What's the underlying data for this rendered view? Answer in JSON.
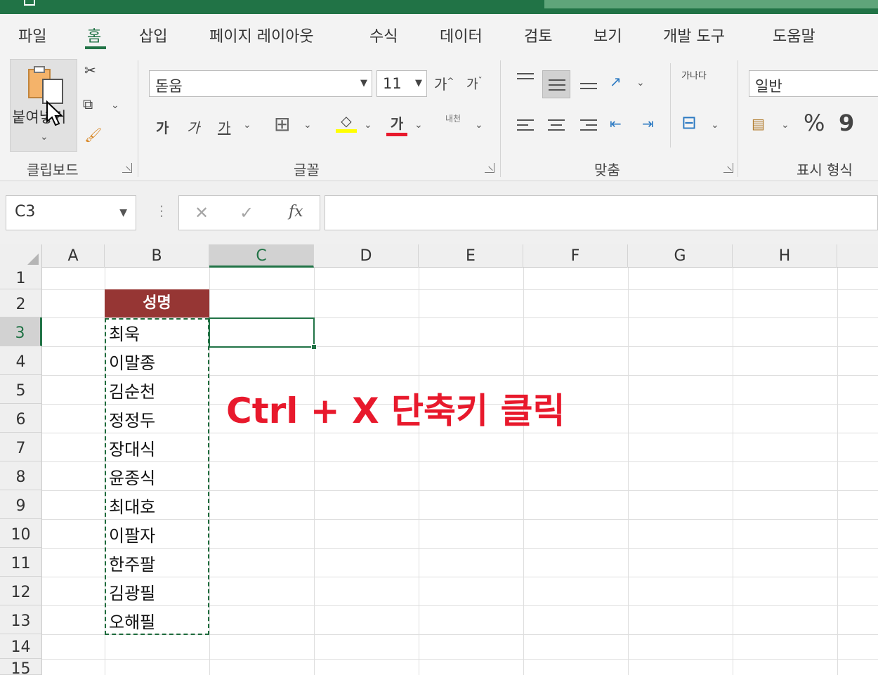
{
  "ribbon_tabs": [
    "파일",
    "홈",
    "삽입",
    "페이지 레이아웃",
    "수식",
    "데이터",
    "검토",
    "보기",
    "개발 도구",
    "도움말"
  ],
  "clipboard": {
    "paste_label": "붙여넣기",
    "group_label": "클립보드"
  },
  "font": {
    "name": "돋움",
    "size": "11",
    "group_label": "글꼴",
    "grow_label": "가",
    "shrink_label": "가",
    "bold": "가",
    "italic": "가",
    "underline": "가",
    "font_color_label": "가",
    "phonetic_label": "내천"
  },
  "alignment": {
    "group_label": "맞춤",
    "wrap_label": "가나다"
  },
  "number": {
    "format": "일반",
    "group_label": "표시 형식",
    "percent": "%",
    "comma": "9"
  },
  "formula_bar": {
    "name_box": "C3",
    "fx": "fx",
    "cancel": "✕",
    "enter": "✓"
  },
  "columns": [
    "A",
    "B",
    "C",
    "D",
    "E",
    "F",
    "G",
    "H"
  ],
  "rows": [
    "1",
    "2",
    "3",
    "4",
    "5",
    "6",
    "7",
    "8",
    "9",
    "10",
    "11",
    "12",
    "13",
    "14",
    "15"
  ],
  "table": {
    "header": "성명",
    "names": [
      "최욱",
      "이말종",
      "김순천",
      "정정두",
      "장대식",
      "윤종식",
      "최대호",
      "이팔자",
      "한주팔",
      "김광필",
      "오해필"
    ]
  },
  "annotation": "Ctrl + X 단축키 클릭",
  "colors": {
    "excel_green": "#217346",
    "header_fill": "#963634",
    "annotation_red": "#e8192c"
  }
}
